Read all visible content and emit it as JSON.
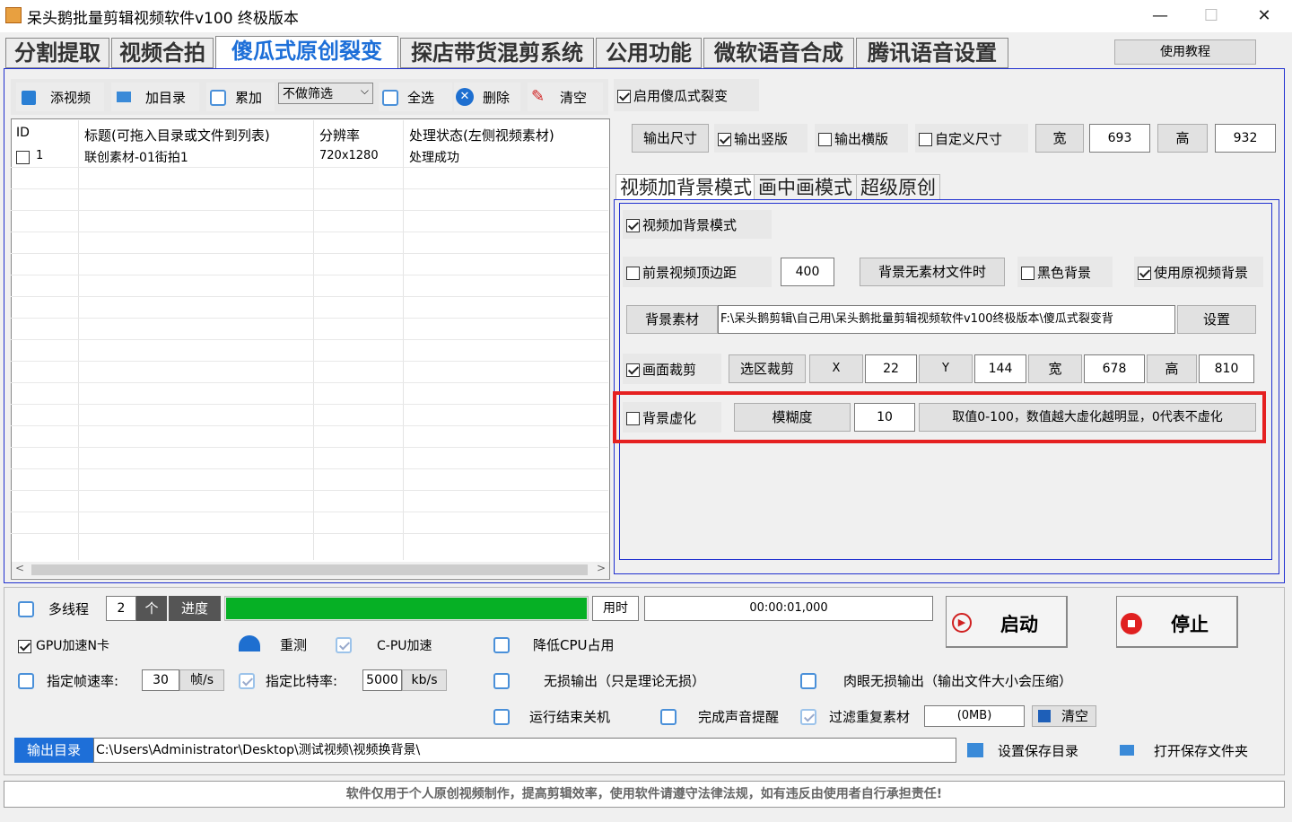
{
  "window": {
    "title": "呆头鹅批量剪辑视频软件v100 终极版本",
    "min": "—",
    "max": "☐",
    "close": "✕"
  },
  "tabs": [
    "分割提取",
    "视频合拍",
    "傻瓜式原创裂变",
    "探店带货混剪系统",
    "公用功能",
    "微软语音合成",
    "腾讯语音设置"
  ],
  "tutorial_button": "使用教程",
  "toolbar": {
    "add_video": "添视频",
    "add_dir": "加目录",
    "accumulate": "累加",
    "filter": "不做筛选",
    "select_all": "全选",
    "delete": "删除",
    "clear": "清空"
  },
  "table": {
    "headers": [
      "ID",
      "标题(可拖入目录或文件到列表)",
      "分辨率",
      "处理状态(左侧视频素材)"
    ],
    "rows": [
      {
        "id": "1",
        "title": "联创素材-01街拍1",
        "resolution": "720x1280",
        "status": "处理成功"
      }
    ]
  },
  "right": {
    "enable_label": "启用傻瓜式裂变",
    "output_size_btn": "输出尺寸",
    "vertical": "输出竖版",
    "horizontal": "输出横版",
    "custom_size": "自定义尺寸",
    "width_lbl": "宽",
    "width_val": "693",
    "height_lbl": "高",
    "height_val": "932",
    "subtabs": [
      "视频加背景模式",
      "画中画模式",
      "超级原创"
    ],
    "bg_mode": "视频加背景模式",
    "fg_top_margin": "前景视频顶边距",
    "fg_top_val": "400",
    "bg_no_file": "背景无素材文件时",
    "black_bg": "黑色背景",
    "use_orig_bg": "使用原视频背景",
    "bg_material_btn": "背景素材",
    "bg_path": "F:\\呆头鹅剪辑\\自己用\\呆头鹅批量剪辑视频软件v100终极版本\\傻瓜式裂变背",
    "set_btn": "设置",
    "crop": "画面裁剪",
    "crop_select": "选区裁剪",
    "x_lbl": "X",
    "x_val": "22",
    "y_lbl": "Y",
    "y_val": "144",
    "w_lbl": "宽",
    "w_val": "678",
    "h_lbl": "高",
    "h_val": "810",
    "blur": "背景虚化",
    "blur_degree": "模糊度",
    "blur_val": "10",
    "blur_hint": "取值0-100，数值越大虚化越明显，0代表不虚化"
  },
  "bottom": {
    "multithread": "多线程",
    "threads": "2",
    "unit": "个",
    "progress_lbl": "进度",
    "progress": 1.0,
    "time_lbl": "用时",
    "time_val": "00:00:01,000",
    "start": "启动",
    "stop": "停止",
    "gpu": "GPU加速N卡",
    "retest": "重测",
    "cpu_accel": "C-PU加速",
    "low_cpu": "降低CPU占用",
    "fps_lbl": "指定帧速率:",
    "fps_val": "30",
    "fps_unit": "帧/s",
    "bitrate_lbl": "指定比特率:",
    "bitrate_val": "5000",
    "bitrate_unit": "kb/s",
    "lossless": "无损输出（只是理论无损）",
    "visual_lossless": "肉眼无损输出（输出文件大小会压缩）",
    "shutdown": "运行结束关机",
    "sound": "完成声音提醒",
    "filter_dup": "过滤重复素材",
    "cache": "(0MB)",
    "clear": "清空",
    "output_dir_lbl": "输出目录",
    "output_dir": "C:\\Users\\Administrator\\Desktop\\测试视频\\视频换背景\\",
    "set_save_dir": "设置保存目录",
    "open_save_dir": "打开保存文件夹"
  },
  "footer": "软件仅用于个人原创视频制作，提高剪辑效率，使用软件请遵守法律法规，如有违反由使用者自行承担责任!"
}
